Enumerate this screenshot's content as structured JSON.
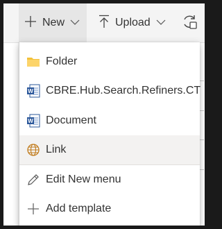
{
  "toolbar": {
    "new_label": "New",
    "upload_label": "Upload"
  },
  "menu": {
    "items": [
      {
        "label": "Folder",
        "icon": "folder-icon"
      },
      {
        "label": "CBRE.Hub.Search.Refiners.CT",
        "icon": "word-doc-icon"
      },
      {
        "label": "Document",
        "icon": "word-doc-icon"
      },
      {
        "label": "Link",
        "icon": "globe-icon"
      },
      {
        "label": "Edit New menu",
        "icon": "pencil-icon"
      },
      {
        "label": "Add template",
        "icon": "plus-icon"
      }
    ],
    "hovered_item": "Link"
  },
  "colors": {
    "accent": "#0078d4",
    "folder": "#f3c13a",
    "word": "#2b579a",
    "text": "#333333",
    "hover_bg": "#f3f2f1"
  }
}
